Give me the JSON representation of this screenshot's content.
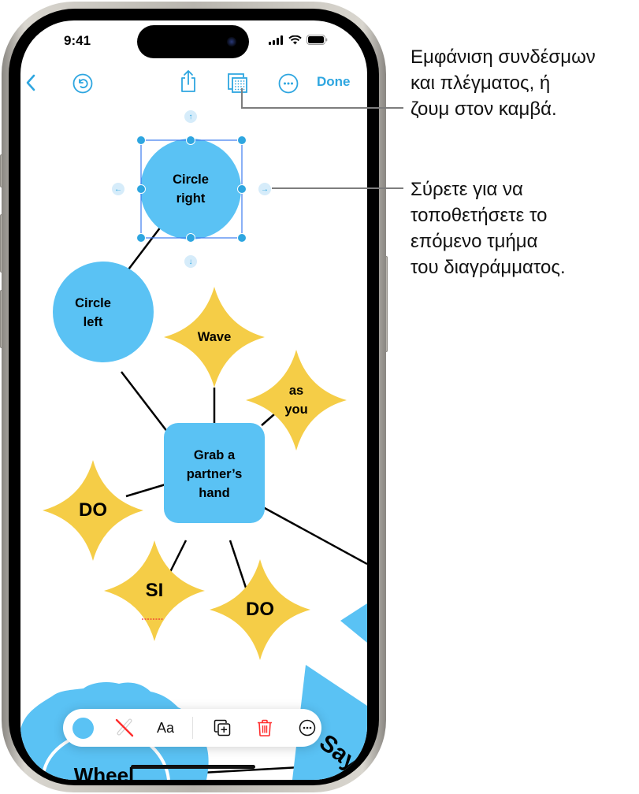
{
  "status_bar": {
    "time": "9:41",
    "icons": [
      "cellular-signal-icon",
      "wifi-icon",
      "battery-icon"
    ]
  },
  "nav_bar": {
    "back_icon": "chevron-left-icon",
    "undo_icon": "undo-icon",
    "share_icon": "share-icon",
    "view_options_icon": "grid-view-icon",
    "more_icon": "ellipsis-circle-icon",
    "done_label": "Done"
  },
  "diagram": {
    "colors": {
      "blue": "#5ac2f4",
      "yellow": "#f5cd47",
      "selection": "#3d7bf0",
      "handle": "#2ea6e0",
      "connector": "#000000"
    },
    "nodes": [
      {
        "id": "circle-right",
        "shape": "circle",
        "label_lines": [
          "Circle",
          "right"
        ],
        "selected": true
      },
      {
        "id": "circle-left",
        "shape": "circle",
        "label_lines": [
          "Circle",
          "left"
        ]
      },
      {
        "id": "wave",
        "shape": "star4",
        "label_lines": [
          "Wave"
        ]
      },
      {
        "id": "as-you",
        "shape": "star4",
        "label_lines": [
          "as",
          "you"
        ]
      },
      {
        "id": "grab-hand",
        "shape": "rounded-square",
        "label_lines": [
          "Grab a",
          "partner’s",
          "hand"
        ]
      },
      {
        "id": "do-left",
        "shape": "star4",
        "label_lines": [
          "DO"
        ]
      },
      {
        "id": "si",
        "shape": "star4",
        "label_lines": [
          "SI"
        ]
      },
      {
        "id": "do-bottom",
        "shape": "star4",
        "label_lines": [
          "DO"
        ]
      },
      {
        "id": "wheel",
        "shape": "cloud",
        "label_lines": [
          "Wheel"
        ]
      },
      {
        "id": "say",
        "shape": "triangle",
        "label_lines": [
          "Say"
        ]
      }
    ],
    "nudge_arrows": {
      "up": "↑",
      "down": "↓",
      "left": "←",
      "right": "→"
    }
  },
  "shape_toolbar": {
    "items": [
      {
        "name": "fill-color-button",
        "icon": "color-swatch-icon"
      },
      {
        "name": "no-stroke-button",
        "icon": "line-none-icon"
      },
      {
        "name": "text-style-button",
        "label": "Aa"
      },
      {
        "name": "duplicate-button",
        "icon": "duplicate-icon"
      },
      {
        "name": "delete-button",
        "icon": "trash-icon"
      },
      {
        "name": "more-options-button",
        "icon": "ellipsis-circle-icon"
      }
    ],
    "text_style_label": "Aa",
    "delete_color": "#ff2d2d"
  },
  "callouts": [
    {
      "id": "view-options",
      "lines": [
        "Εμφάνιση συνδέσμων",
        "και πλέγματος, ή",
        "ζουμ στον καμβά."
      ]
    },
    {
      "id": "drag-next",
      "lines": [
        "Σύρετε για να",
        "τοποθετήσετε το",
        "επόμενο τμήμα",
        "του διαγράμματος."
      ]
    }
  ]
}
